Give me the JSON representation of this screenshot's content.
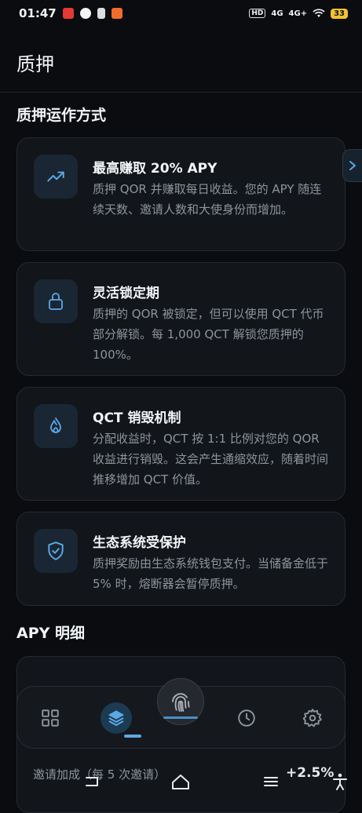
{
  "status_bar": {
    "time": "01:47",
    "network_tag": "HD",
    "signal_1": "4G",
    "signal_2": "4G+",
    "battery": "33"
  },
  "header": {
    "title": "质押"
  },
  "how_it_works": {
    "title": "质押运作方式",
    "cards": [
      {
        "icon": "trending-up-icon",
        "title": "最高赚取 20% APY",
        "description": "质押 QOR 并赚取每日收益。您的 APY 随连续天数、邀请人数和大使身份而增加。"
      },
      {
        "icon": "lock-icon",
        "title": "灵活锁定期",
        "description": "质押的 QOR 被锁定，但可以使用 QCT 代币部分解锁。每 1,000 QCT 解锁您质押的 100%。"
      },
      {
        "icon": "flame-icon",
        "title": "QCT 销毁机制",
        "description": "分配收益时，QCT 按 1:1 比例对您的 QOR 收益进行销毁。这会产生通缩效应，随着时间推移增加 QCT 价值。"
      },
      {
        "icon": "shield-check-icon",
        "title": "生态系统受保护",
        "description": "质押奖励由生态系统钱包支付。当储备金低于 5% 时，熔断器会暂停质押。"
      }
    ]
  },
  "apy_breakdown": {
    "title": "APY 明细",
    "row_label": "邀请加成（每 5 次邀请）",
    "row_value": "+2.5%"
  },
  "bottom_nav": {
    "items": [
      "grid-icon",
      "layers-icon",
      "fingerprint-icon",
      "clock-icon",
      "gear-icon"
    ],
    "active": "layers-icon",
    "accent_color": "#5aa9e6"
  }
}
